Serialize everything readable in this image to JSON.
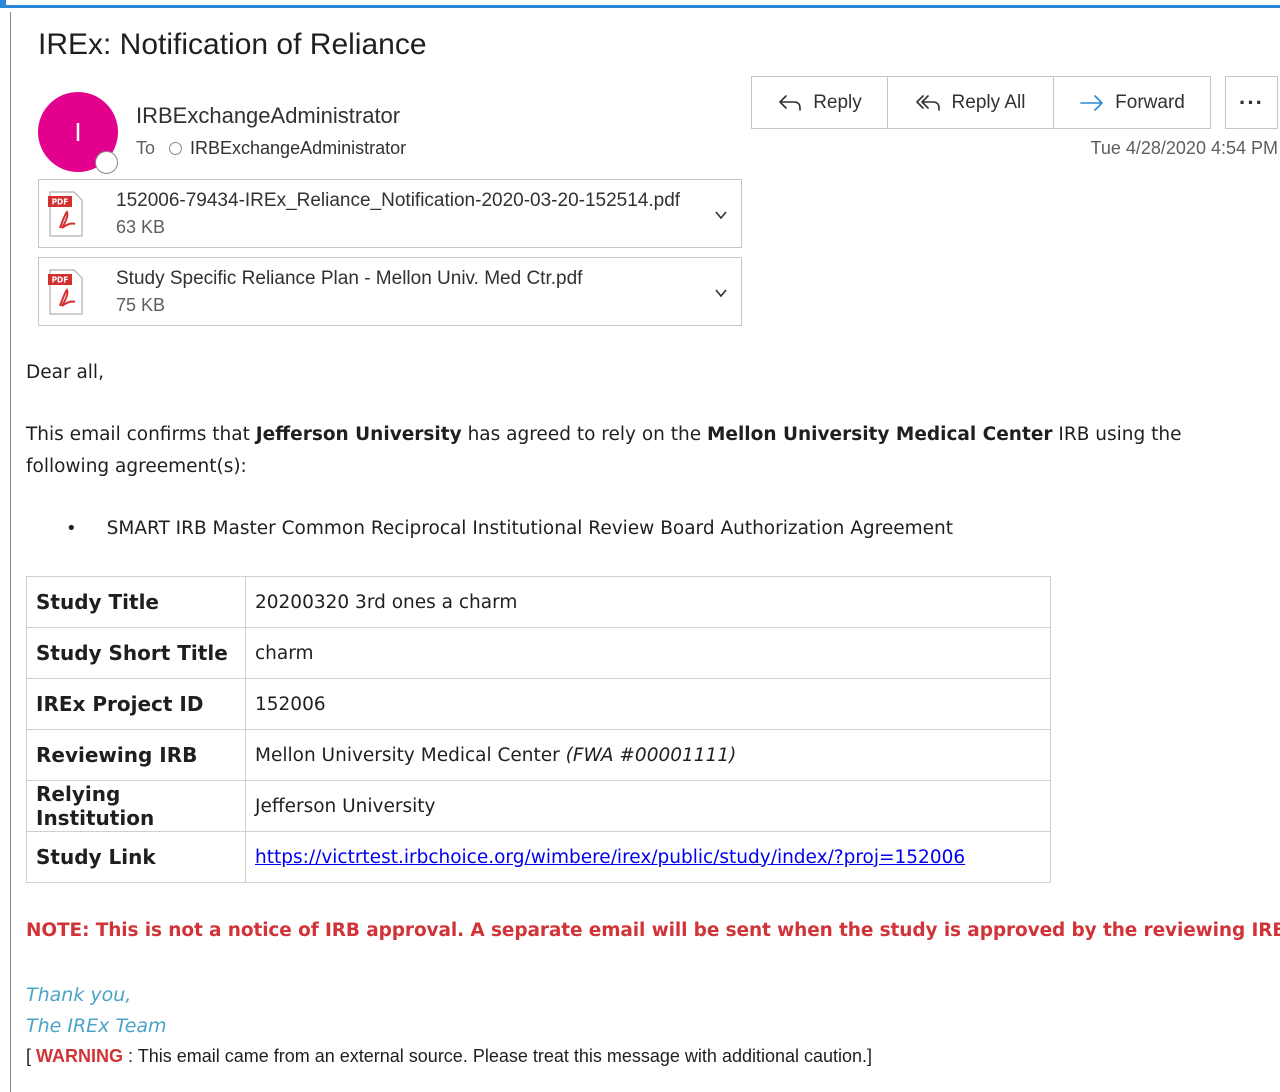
{
  "email": {
    "subject": "IREx: Notification of Reliance",
    "sender_name": "IRBExchangeAdministrator",
    "avatar_initial": "I",
    "avatar_color": "#e3008c",
    "to_label": "To",
    "to_recipient": "IRBExchangeAdministrator",
    "date": "Tue 4/28/2020 4:54 PM"
  },
  "actions": {
    "reply": "Reply",
    "reply_all": "Reply All",
    "forward": "Forward",
    "more": "···"
  },
  "attachments": [
    {
      "name": "152006-79434-IREx_Reliance_Notification-2020-03-20-152514.pdf",
      "size": "63 KB",
      "icon": "pdf-icon"
    },
    {
      "name": "Study Specific Reliance Plan - Mellon Univ. Med Ctr.pdf",
      "size": "75 KB",
      "icon": "pdf-icon"
    }
  ],
  "body": {
    "greeting": "Dear all,",
    "confirm_pre": "This email confirms that ",
    "confirm_inst": "Jefferson University",
    "confirm_mid": " has agreed to rely on the ",
    "confirm_irb": "Mellon University Medical Center",
    "confirm_post": " IRB using the following agreement(s):",
    "bullet": "SMART IRB Master Common Reciprocal Institutional Review Board Authorization Agreement",
    "note": "NOTE: This is not a notice of IRB approval. A separate email will be sent when the study is approved by the reviewing IRB.",
    "thanks": "Thank you,",
    "team": "The IREx Team",
    "warning_open": "[ ",
    "warning_word": "WARNING",
    "warning_rest": " : This email came from an external source. Please treat this message with additional caution.]"
  },
  "study_table": {
    "rows": [
      {
        "label": "Study Title",
        "value": "20200320 3rd ones a charm"
      },
      {
        "label": "Study Short Title",
        "value": "charm"
      },
      {
        "label": "IREx Project ID",
        "value": "152006"
      },
      {
        "label": "Reviewing IRB",
        "value": "Mellon University Medical Center ",
        "value_italic": "(FWA #00001111)"
      },
      {
        "label": "Relying Institution",
        "value": "Jefferson University"
      },
      {
        "label": "Study Link",
        "link": "https://victrtest.irbchoice.org/wimbere/irex/public/study/index/?proj=152006"
      }
    ]
  },
  "colors": {
    "accent": "#2b88d8",
    "note_red": "#d13438",
    "signoff_teal": "#4ba3c7",
    "link_blue": "#0000ee"
  }
}
